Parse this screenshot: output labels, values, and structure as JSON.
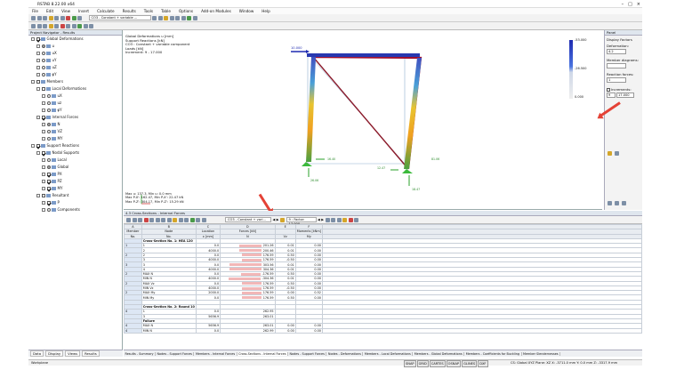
{
  "app": {
    "title": "RSTAB 8.22.00 x64"
  },
  "menu": [
    "File",
    "Edit",
    "View",
    "Insert",
    "Calculate",
    "Results",
    "Tools",
    "Table",
    "Options",
    "Add-on Modules",
    "Window",
    "Help"
  ],
  "toolbar": {
    "load_case": "CO3 - Constant + variable ..."
  },
  "navigator": {
    "title": "Project Navigator - Results",
    "items": [
      {
        "label": "Global Deformations",
        "kind": "check",
        "on": true,
        "indent": 0
      },
      {
        "label": "u",
        "kind": "radio",
        "on": true,
        "indent": 1
      },
      {
        "label": "uX",
        "kind": "radio",
        "on": false,
        "indent": 1
      },
      {
        "label": "uY",
        "kind": "radio",
        "on": false,
        "indent": 1
      },
      {
        "label": "uZ",
        "kind": "radio",
        "on": false,
        "indent": 1
      },
      {
        "label": "φY",
        "kind": "radio",
        "on": false,
        "indent": 1
      },
      {
        "label": "Members",
        "kind": "check",
        "on": false,
        "indent": 0
      },
      {
        "label": "Local Deformations",
        "kind": "check",
        "on": false,
        "indent": 1
      },
      {
        "label": "uX",
        "kind": "radio",
        "on": false,
        "indent": 2
      },
      {
        "label": "uz",
        "kind": "radio",
        "on": false,
        "indent": 2
      },
      {
        "label": "φY",
        "kind": "radio",
        "on": false,
        "indent": 2
      },
      {
        "label": "Internal Forces",
        "kind": "check",
        "on": true,
        "indent": 1
      },
      {
        "label": "N",
        "kind": "radio",
        "on": true,
        "indent": 2
      },
      {
        "label": "VZ",
        "kind": "radio",
        "on": false,
        "indent": 2
      },
      {
        "label": "MY",
        "kind": "radio",
        "on": false,
        "indent": 2
      },
      {
        "label": "Support Reactions",
        "kind": "check",
        "on": true,
        "indent": 0
      },
      {
        "label": "Nodal Supports",
        "kind": "check",
        "on": true,
        "indent": 1
      },
      {
        "label": "Local",
        "kind": "radio",
        "on": false,
        "indent": 2
      },
      {
        "label": "Global",
        "kind": "radio",
        "on": true,
        "indent": 2
      },
      {
        "label": "PX",
        "kind": "check",
        "on": true,
        "indent": 2
      },
      {
        "label": "PZ",
        "kind": "check",
        "on": true,
        "indent": 2
      },
      {
        "label": "MY",
        "kind": "check",
        "on": true,
        "indent": 2
      },
      {
        "label": "Resultant",
        "kind": "check",
        "on": false,
        "indent": 1
      },
      {
        "label": "P",
        "kind": "check",
        "on": true,
        "indent": 2
      },
      {
        "label": "Components",
        "kind": "radio",
        "on": false,
        "indent": 2
      }
    ],
    "tabs": [
      "Data",
      "Display",
      "Views",
      "Results"
    ]
  },
  "view": {
    "info": [
      "Global Deformations u [mm]",
      "Support Reactions [kN]",
      "CO3 : Constant + variable component",
      "Loads [kN]",
      "Increment: 9 - 17.000"
    ],
    "footer": [
      "Max u: 137.3, Min u: 0.0 mm",
      "Max P-X': 162.47, Min P-X': 22.47 kN",
      "Max P-Z': 304.17, Min P-Z': 15.29 kN"
    ],
    "load_label": "10.000",
    "scale": [
      "-53.000",
      "-26.500",
      "0.000"
    ],
    "reaction_labels": [
      "16.40",
      "26.06",
      "12.47",
      "18.47",
      "81.06"
    ]
  },
  "panel": {
    "title": "Panel",
    "heading": "Display Factors",
    "deformation_label": "Deformation:",
    "deformation_value": "4.2",
    "member_diagrams_label": "Member diagrams:",
    "reaction_forces_label": "Reaction forces:",
    "reaction_forces_value": "1",
    "increments_label": "Increments:",
    "increments_value": "9",
    "increments_extra": "17.000"
  },
  "grid": {
    "title": "4.3 Cross-Sections - Internal Forces",
    "combo": "CO3 - Constant + vari...",
    "factor": "9 : Factor: 17.000",
    "col_letters": [
      "A",
      "B",
      "C",
      "D",
      "E",
      "F"
    ],
    "headers1": [
      "Member",
      "Node",
      "Location",
      "Forces [kN]",
      "",
      "Moments [kNm]"
    ],
    "headers2": [
      "No.",
      "No.",
      "x [mm]",
      "N",
      "Vz",
      "My"
    ],
    "rows": [
      {
        "c": [
          "",
          "Cross-Section No. 1: HEA 120",
          "",
          "",
          "",
          ""
        ],
        "section": true
      },
      {
        "c": [
          "1",
          "1",
          "0.0",
          "201.26",
          "0.01",
          "0.00"
        ],
        "bar": 60
      },
      {
        "c": [
          "",
          "2",
          "4000.0",
          "200.46",
          "0.01",
          "0.00"
        ],
        "bar": 60
      },
      {
        "c": [
          "2",
          "2",
          "0.0",
          "176.59",
          "0.50",
          "0.00"
        ],
        "bar": 52
      },
      {
        "c": [
          "",
          "3",
          "4000.0",
          "176.59",
          "-0.50",
          "0.00"
        ],
        "bar": 52
      },
      {
        "c": [
          "3",
          "3",
          "0.0",
          "303.56",
          "0.01",
          "0.00"
        ],
        "bar": 85
      },
      {
        "c": [
          "",
          "4",
          "4000.0",
          "304.36",
          "0.01",
          "0.00"
        ],
        "bar": 85
      },
      {
        "c": [
          "2",
          "MAX N",
          "0.0",
          "-176.59",
          "0.50",
          "0.00"
        ],
        "bar": 52
      },
      {
        "c": [
          "",
          "MIN N",
          "4000.0",
          "-304.36",
          "0.01",
          "0.00"
        ],
        "bar": 85
      },
      {
        "c": [
          "2",
          "MAX Vz",
          "0.0",
          "176.59",
          "0.50",
          "0.00"
        ],
        "bar": 52
      },
      {
        "c": [
          "",
          "MIN Vz",
          "4000.0",
          "176.59",
          "-0.50",
          "0.00"
        ],
        "bar": 52
      },
      {
        "c": [
          "2",
          "MAX My",
          "2000.0",
          "176.59",
          "0.00",
          "0.52"
        ],
        "bar": 52
      },
      {
        "c": [
          "",
          "MIN My",
          "0.0",
          "176.59",
          "0.50",
          "0.00"
        ],
        "bar": 52
      },
      {
        "c": [
          "",
          "",
          "",
          "",
          "",
          ""
        ]
      },
      {
        "c": [
          "",
          "Cross-Section No. 2: Round 10",
          "",
          "",
          "",
          ""
        ],
        "section": true
      },
      {
        "c": [
          "4",
          "1",
          "0.0",
          "262.95",
          "",
          ""
        ]
      },
      {
        "c": [
          "",
          "3",
          "5656.9",
          "263.01",
          "",
          ""
        ]
      },
      {
        "c": [
          "",
          "Failure",
          "",
          "",
          "",
          ""
        ],
        "section": true
      },
      {
        "c": [
          "4",
          "MAX N",
          "5656.9",
          "263.01",
          "0.00",
          "0.00"
        ]
      },
      {
        "c": [
          "4",
          "MIN N",
          "0.0",
          "262.99",
          "0.00",
          "0.00"
        ]
      }
    ],
    "tabs": [
      "Results - Summary",
      "Nodes - Support Forces",
      "Members - Internal Forces",
      "Cross-Sections - Internal Forces",
      "Nodes - Support Forces",
      "Nodes - Deformations",
      "Members - Local Deformations",
      "Members - Global Deformations",
      "Members - Coefficients for Buckling",
      "Member Slendernesses"
    ],
    "active_tab": 3
  },
  "status": {
    "left": "Workplane",
    "toggles": [
      "SNAP",
      "GRID",
      "CARTES",
      "OSNAP",
      "GLINES",
      "DXF"
    ],
    "cs": "CS: Global XYZ    Plane: XZ       X: -3711.0 mm  Y: 0.0 mm      Z: -3317.9 mm"
  }
}
